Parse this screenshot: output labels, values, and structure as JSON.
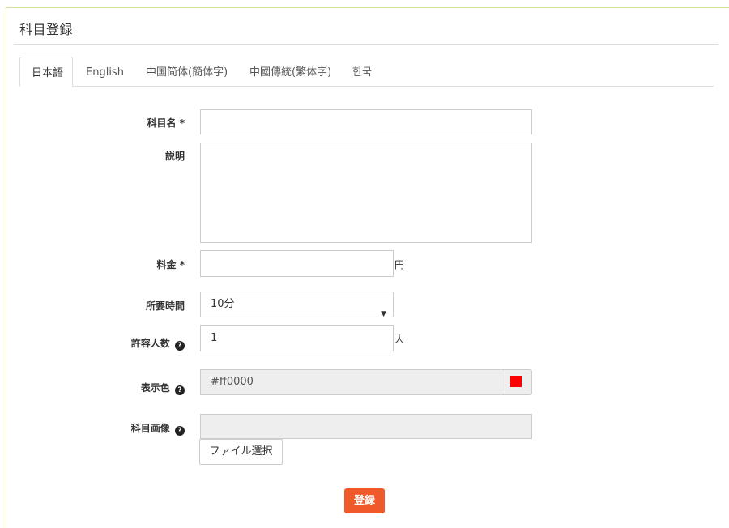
{
  "panel": {
    "title": "科目登録"
  },
  "tabs": [
    {
      "label": "日本語",
      "active": true
    },
    {
      "label": "English",
      "active": false
    },
    {
      "label": "中国简体(簡体字)",
      "active": false
    },
    {
      "label": "中國傳統(繁体字)",
      "active": false
    },
    {
      "label": "한국",
      "active": false
    }
  ],
  "form": {
    "name": {
      "label": "科目名 *",
      "value": ""
    },
    "description": {
      "label": "説明",
      "value": ""
    },
    "price": {
      "label": "料金 *",
      "value": "",
      "suffix": "円"
    },
    "duration": {
      "label": "所要時間",
      "selected": "10分"
    },
    "capacity": {
      "label": "許容人数",
      "value": "1",
      "suffix": "人"
    },
    "color": {
      "label": "表示色",
      "value": "#ff0000",
      "swatch": "#ff0000"
    },
    "image": {
      "label": "科目画像",
      "value": "",
      "file_button": "ファイル選択"
    }
  },
  "submit": {
    "label": "登録",
    "color": "#f0592a"
  }
}
